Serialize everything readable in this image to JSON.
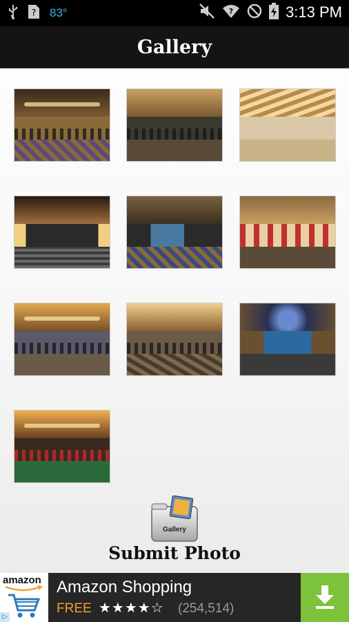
{
  "status_bar": {
    "temperature": "83°",
    "time": "3:13 PM"
  },
  "header": {
    "title": "Gallery"
  },
  "gallery": {
    "photos": [
      {
        "name": "casino-photo-1"
      },
      {
        "name": "casino-photo-2"
      },
      {
        "name": "casino-photo-3"
      },
      {
        "name": "casino-photo-4"
      },
      {
        "name": "casino-photo-5"
      },
      {
        "name": "casino-photo-6"
      },
      {
        "name": "casino-photo-7"
      },
      {
        "name": "casino-photo-8"
      },
      {
        "name": "casino-photo-9"
      },
      {
        "name": "casino-photo-10"
      }
    ]
  },
  "submit": {
    "icon_caption": "Gallery",
    "label": "Submit Photo"
  },
  "ad": {
    "brand": "amazon",
    "app_name": "Amazon Shopping",
    "price": "FREE",
    "rating_stars": "★★★★☆",
    "rating_count": "(254,514)",
    "download_color": "#7cc23a"
  }
}
